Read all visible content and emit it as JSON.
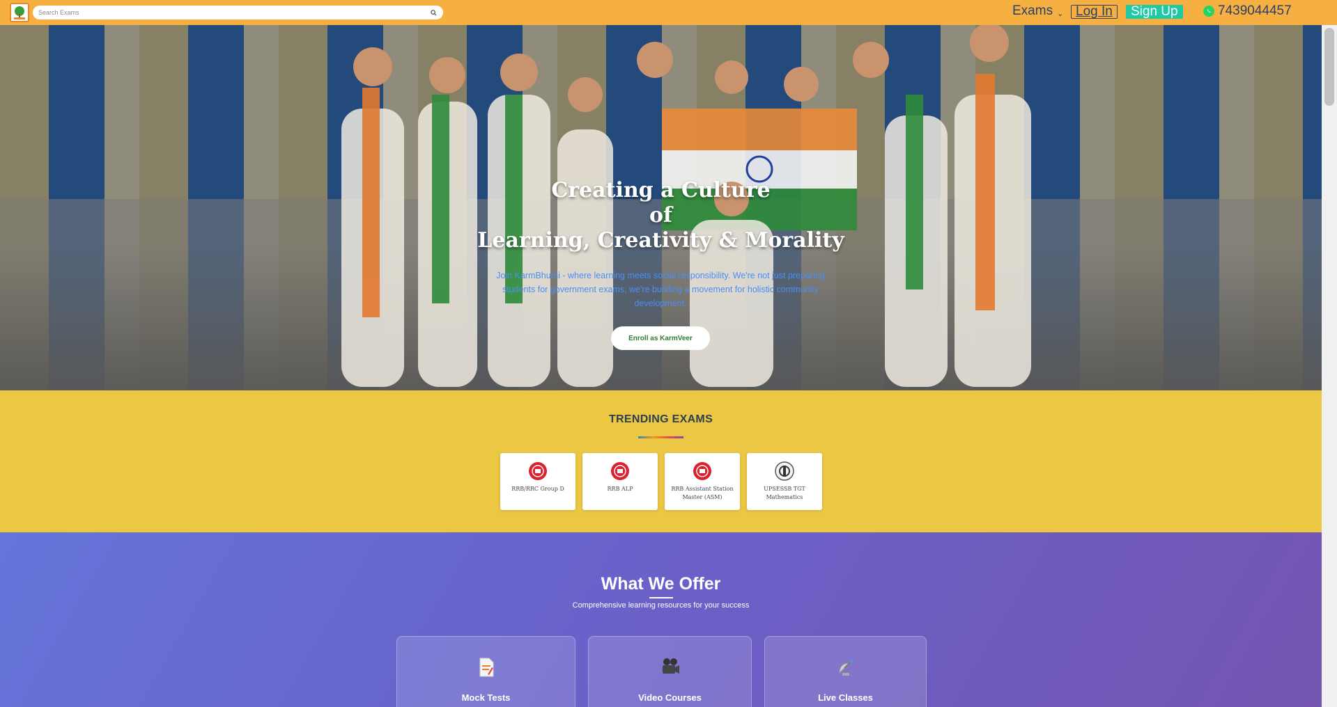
{
  "header": {
    "search_placeholder": "Search Exams",
    "exams_label": "Exams",
    "login_label": "Log In",
    "signup_label": "Sign Up",
    "phone": "7439044457"
  },
  "hero": {
    "title_line1": "Creating a Culture",
    "title_line2": "of",
    "title_line3": "Learning, Creativity & Morality",
    "subtitle": "Join KarmBhumi - where learning meets social responsibility. We're not just preparing students for government exams, we're building a movement for holistic community development.",
    "cta_label": "Enroll as KarmVeer"
  },
  "trending": {
    "title": "TRENDING EXAMS",
    "exams": [
      {
        "name": "RRB/RRC Group D",
        "icon": "railway-logo-icon"
      },
      {
        "name": "RRB ALP",
        "icon": "railway-logo-icon"
      },
      {
        "name": "RRB Assistant Station Master (ASM)",
        "icon": "railway-logo-icon"
      },
      {
        "name": "UPSESSB TGT Mathematics",
        "icon": "upsessb-logo-icon"
      }
    ]
  },
  "offer": {
    "title": "What We Offer",
    "subtitle": "Comprehensive learning resources for your success",
    "items": [
      {
        "label": "Mock Tests",
        "icon": "document-icon"
      },
      {
        "label": "Video Courses",
        "icon": "video-camera-icon"
      },
      {
        "label": "Live Classes",
        "icon": "satellite-icon"
      }
    ]
  },
  "colors": {
    "header_bg": "#f5b041",
    "trending_bg": "#ebc744",
    "signup_bg": "#20c9a6",
    "offer_gradient_start": "#6474d8",
    "offer_gradient_end": "#7355b0"
  }
}
